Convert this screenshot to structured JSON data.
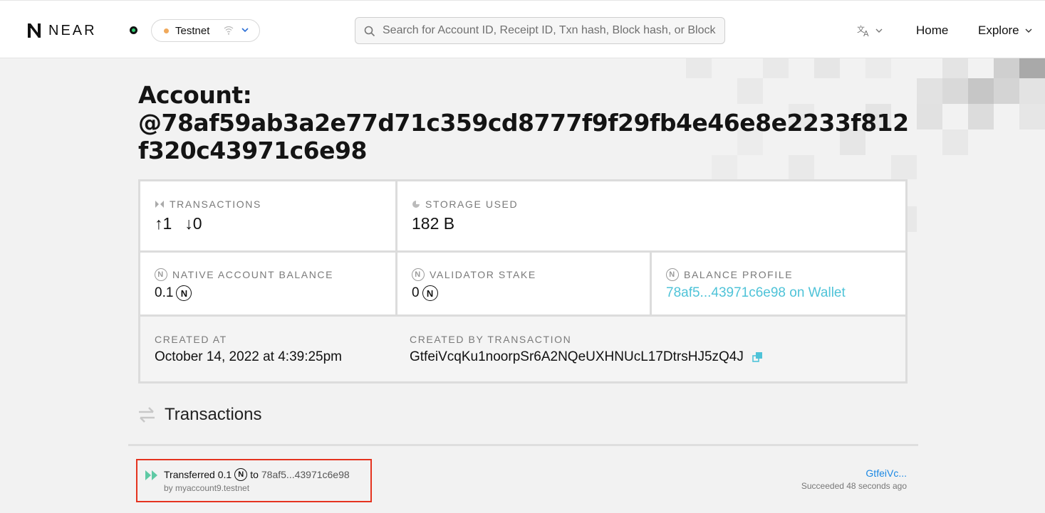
{
  "header": {
    "logo_text": "NEAR",
    "network": "Testnet",
    "search_placeholder": "Search for Account ID, Receipt ID, Txn hash, Block hash, or Block",
    "nav": {
      "home": "Home",
      "explore": "Explore"
    }
  },
  "account": {
    "title_prefix": "Account:",
    "account_id": "@78af59ab3a2e77d71c359cd8777f9f29fb4e46e8e2233f812f320c43971c6e98"
  },
  "stats": {
    "transactions": {
      "label": "TRANSACTIONS",
      "sent": "↑1",
      "received": "↓0"
    },
    "storage": {
      "label": "STORAGE USED",
      "value": "182 B"
    },
    "native_balance": {
      "label": "NATIVE ACCOUNT BALANCE",
      "value": "0.1"
    },
    "validator_stake": {
      "label": "VALIDATOR STAKE",
      "value": "0"
    },
    "balance_profile": {
      "label": "BALANCE PROFILE",
      "value": "78af5...43971c6e98 on Wallet"
    },
    "created_at": {
      "label": "CREATED AT",
      "value": "October 14, 2022 at 4:39:25pm"
    },
    "created_by": {
      "label": "CREATED BY TRANSACTION",
      "value": "GtfeiVcqKu1noorpSr6A2NQeUXHNUcL17DtrsHJ5zQ4J"
    }
  },
  "transactions": {
    "heading": "Transactions",
    "items": [
      {
        "action": "Transferred 0.1",
        "to_label": "to",
        "receiver": "78af5...43971c6e98",
        "by": "by myaccount9.testnet",
        "hash": "GtfeiVc...",
        "status": "Succeeded 48 seconds ago"
      }
    ]
  },
  "colors": {
    "link": "#4fc3d8",
    "hash_link": "#1b88e3",
    "highlight": "#e5331f",
    "network_dot": "#f0a95b"
  }
}
